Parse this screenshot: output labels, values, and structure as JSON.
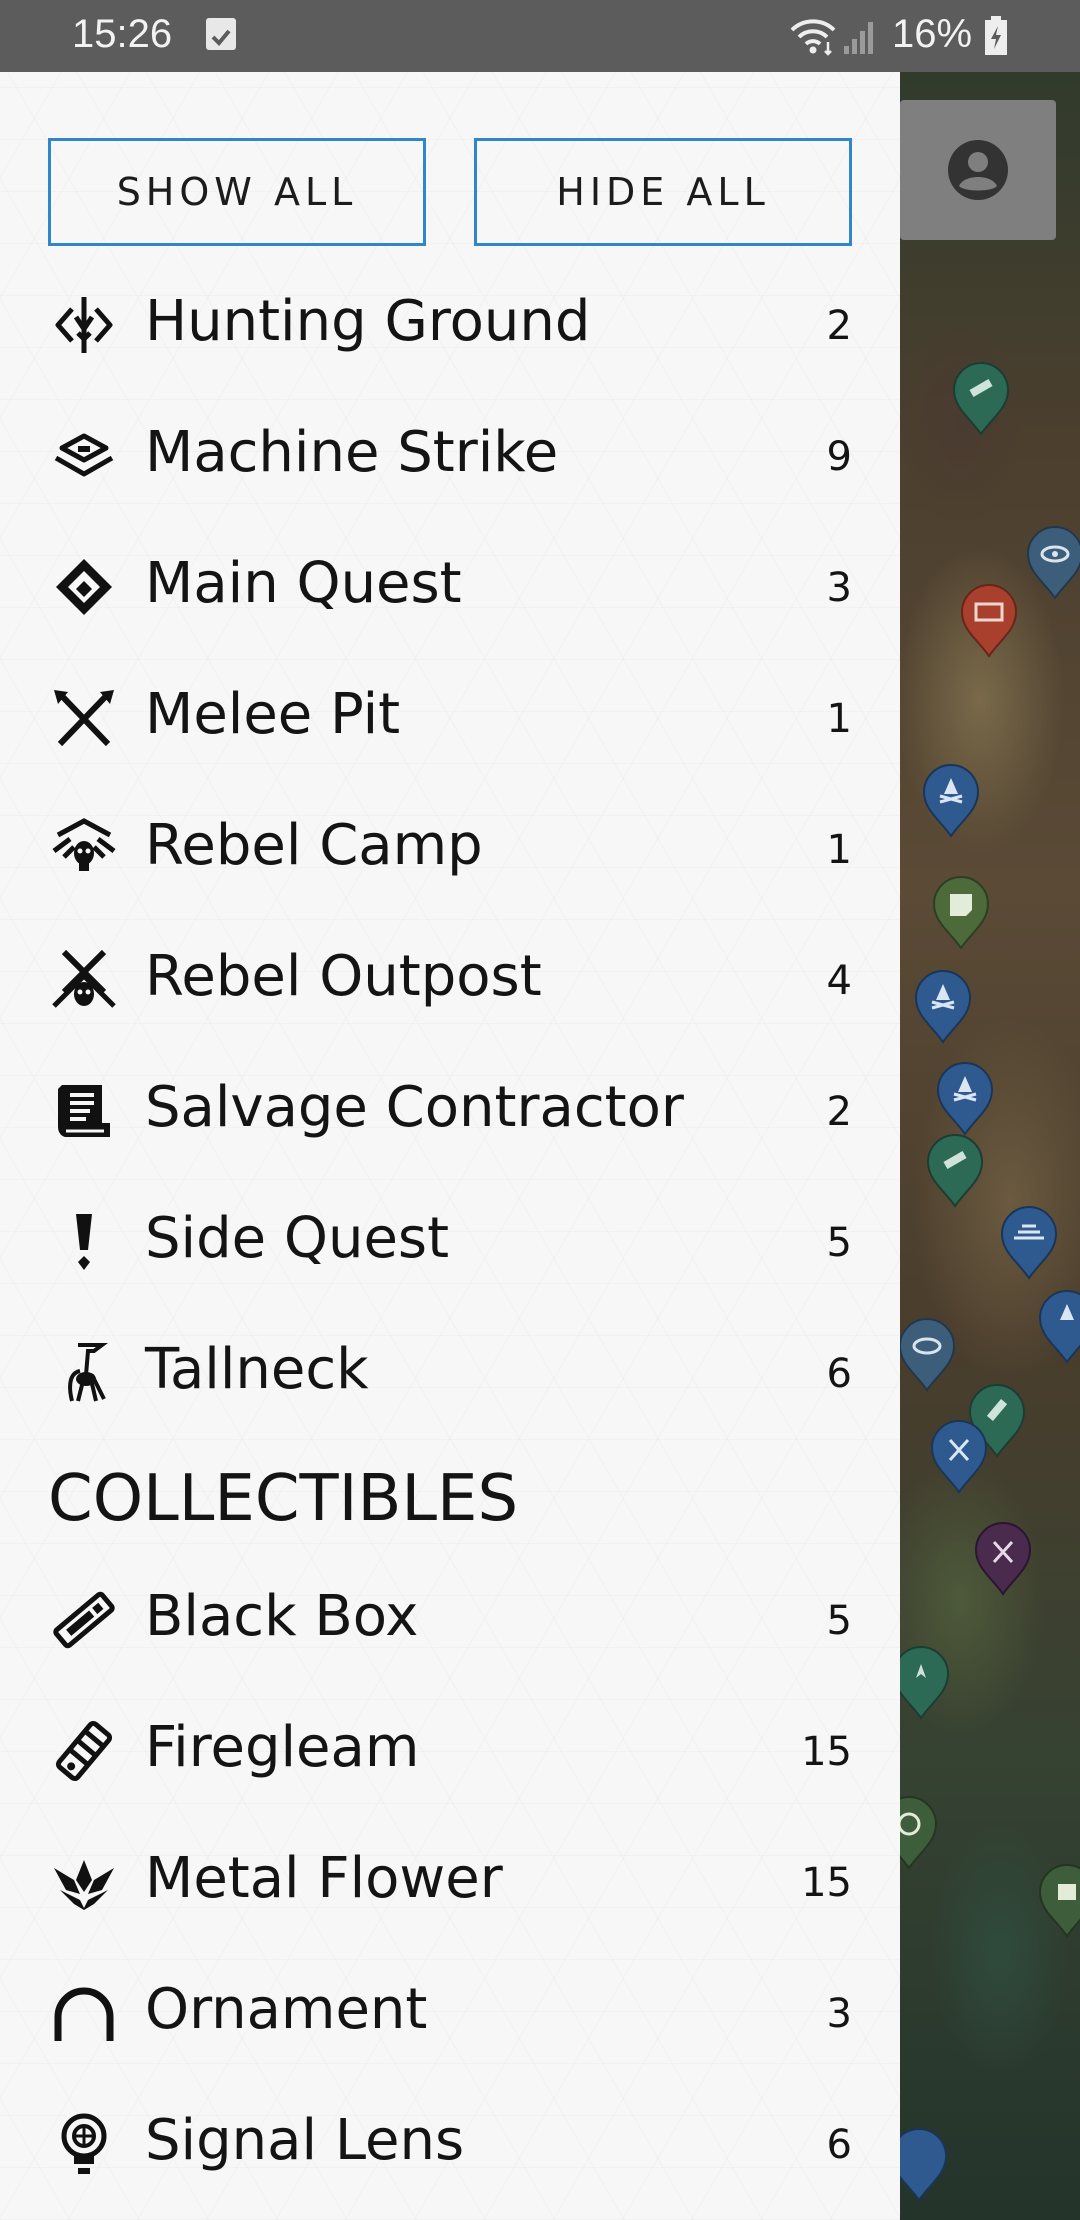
{
  "status_bar": {
    "time": "15:26",
    "battery_percent": "16%",
    "icons": [
      "checkbox-notification-icon",
      "wifi-icon",
      "cell-signal-icon",
      "battery-charging-icon"
    ]
  },
  "map": {
    "account_button_icon": "account-circle-icon"
  },
  "drawer": {
    "show_all_label": "SHOW ALL",
    "hide_all_label": "HIDE ALL",
    "categories": [
      {
        "label": "Hunting Ground",
        "count": "2",
        "icon": "hunting-ground-icon"
      },
      {
        "label": "Machine Strike",
        "count": "9",
        "icon": "machine-strike-icon"
      },
      {
        "label": "Main Quest",
        "count": "3",
        "icon": "main-quest-icon"
      },
      {
        "label": "Melee Pit",
        "count": "1",
        "icon": "melee-pit-icon"
      },
      {
        "label": "Rebel Camp",
        "count": "1",
        "icon": "rebel-camp-icon"
      },
      {
        "label": "Rebel Outpost",
        "count": "4",
        "icon": "rebel-outpost-icon"
      },
      {
        "label": "Salvage Contractor",
        "count": "2",
        "icon": "salvage-contractor-icon"
      },
      {
        "label": "Side Quest",
        "count": "5",
        "icon": "side-quest-icon"
      },
      {
        "label": "Tallneck",
        "count": "6",
        "icon": "tallneck-icon"
      }
    ],
    "collectibles_heading": "COLLECTIBLES",
    "collectibles": [
      {
        "label": "Black Box",
        "count": "5",
        "icon": "black-box-icon"
      },
      {
        "label": "Firegleam",
        "count": "15",
        "icon": "firegleam-icon"
      },
      {
        "label": "Metal Flower",
        "count": "15",
        "icon": "metal-flower-icon"
      },
      {
        "label": "Ornament",
        "count": "3",
        "icon": "ornament-icon"
      },
      {
        "label": "Signal Lens",
        "count": "6",
        "icon": "signal-lens-icon"
      }
    ]
  },
  "colors": {
    "button_border": "#2f86c8",
    "drawer_bg": "#f7f7f7",
    "status_bar_bg": "#5c5c5c",
    "pin_green": "#2d6a55",
    "pin_blue": "#2f5a8f",
    "pin_red": "#a8402d",
    "pin_purple": "#4a2a4d"
  }
}
